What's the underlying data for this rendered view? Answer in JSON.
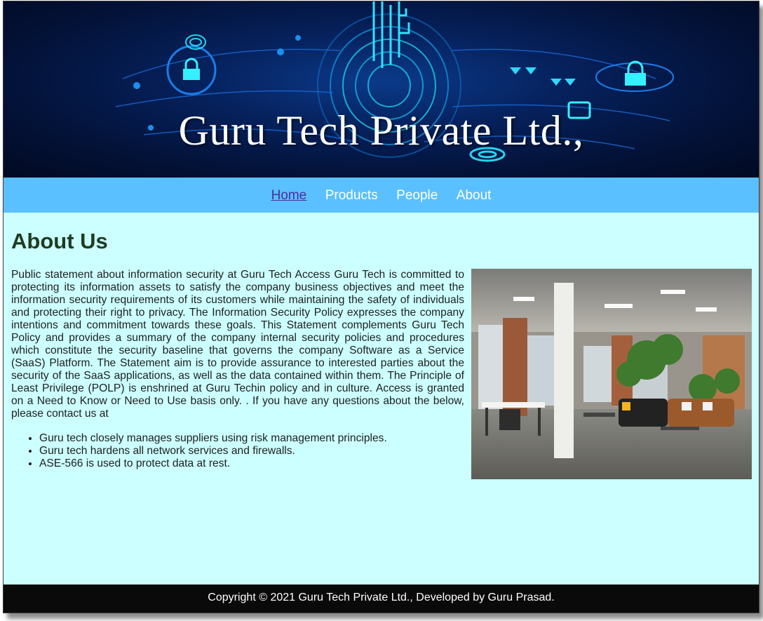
{
  "banner": {
    "title": "Guru Tech Private Ltd.,"
  },
  "nav": {
    "items": [
      {
        "label": "Home",
        "active": true
      },
      {
        "label": "Products",
        "active": false
      },
      {
        "label": "People",
        "active": false
      },
      {
        "label": "About",
        "active": false
      }
    ]
  },
  "main": {
    "heading": "About Us",
    "paragraph": "Public statement about information security at Guru Tech Access Guru Tech is committed to protecting its information assets to satisfy the company business objectives and meet the information security requirements of its customers while maintaining the safety of individuals and protecting their right to privacy. The Information Security Policy expresses the company intentions and commitment towards these goals. This Statement complements Guru Tech Policy and provides a summary of the company internal security policies and procedures which constitute the security baseline that governs the company Software as a Service (SaaS) Platform. The Statement aim is to provide assurance to interested parties about the security of the SaaS applications, as well as the data contained within them. The Principle of Least Privilege (POLP) is enshrined at Guru Techin policy and in culture. Access is granted on a Need to Know or Need to Use basis only. . If you have any questions about the below, please contact us at",
    "bullets": [
      "Guru tech closely manages suppliers using risk management principles.",
      "Guru tech hardens all network services and firewalls.",
      "ASE-566 is used to protect data at rest."
    ]
  },
  "footer": {
    "text": "Copyright © 2021 Guru Tech Private Ltd., Developed by Guru Prasad."
  },
  "colors": {
    "nav_bg": "#5ac0ff",
    "content_bg": "#ccffff",
    "footer_bg": "#0a0a0a",
    "active_link": "#4a2ea5"
  }
}
